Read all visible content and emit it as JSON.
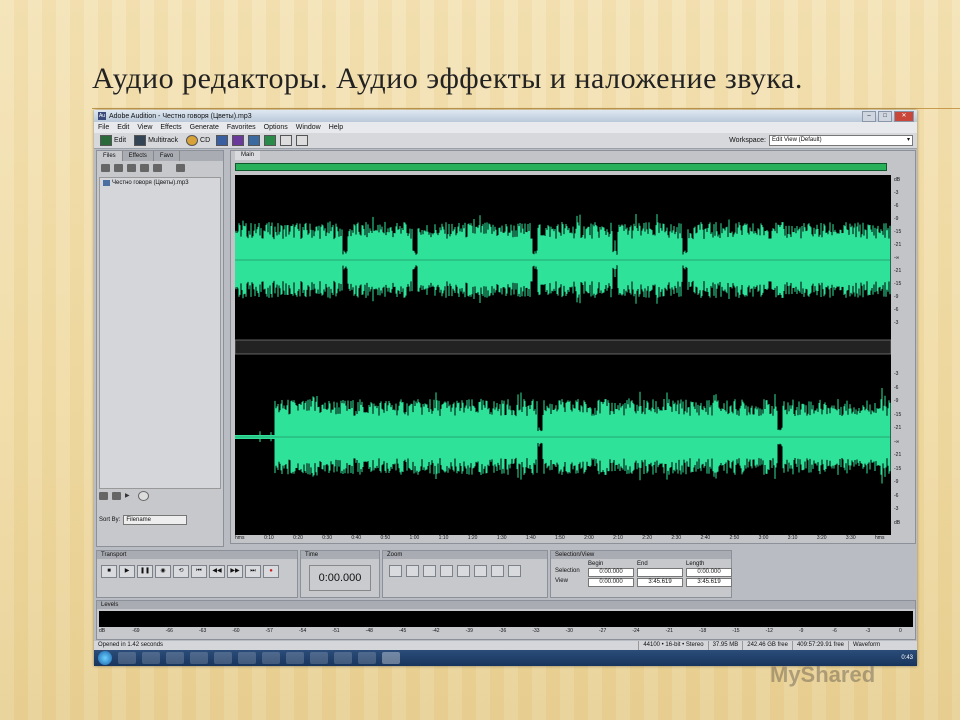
{
  "slide_title": "Аудио редакторы. Аудио эффекты и наложение звука.",
  "watermark": "MyShared",
  "app": {
    "title": "Adobe Audition - Честно говоря (Цветы).mp3",
    "menu": [
      "File",
      "Edit",
      "View",
      "Effects",
      "Generate",
      "Favorites",
      "Options",
      "Window",
      "Help"
    ],
    "toolbar": {
      "edit": "Edit",
      "multitrack": "Multitrack",
      "cd": "CD"
    },
    "workspace_label": "Workspace:",
    "workspace_value": "Edit View (Default)"
  },
  "files_panel": {
    "tabs": [
      "Files",
      "Effects",
      "Favo"
    ],
    "file": "Честно говоря (Цветы).mp3",
    "sort_label": "Sort By:",
    "sort_value": "Filename"
  },
  "editor": {
    "tab": "Main",
    "db_top": [
      "dB",
      "-3",
      "-6",
      "-9",
      "-15",
      "-21",
      "-∞",
      "-21",
      "-15",
      "-9",
      "-6",
      "-3"
    ],
    "db_bottom": [
      "-3",
      "-6",
      "-9",
      "-15",
      "-21",
      "-∞",
      "-21",
      "-15",
      "-9",
      "-6",
      "-3",
      "dB"
    ],
    "timeline": [
      "hms",
      "0:10",
      "0:20",
      "0:30",
      "0:40",
      "0:50",
      "1:00",
      "1:10",
      "1:20",
      "1:30",
      "1:40",
      "1:50",
      "2:00",
      "2:10",
      "2:20",
      "2:30",
      "2:40",
      "2:50",
      "3:00",
      "3:10",
      "3:20",
      "3:30",
      "hms"
    ],
    "wave_color": "#2fe29a"
  },
  "transport": {
    "tab": "Transport"
  },
  "time": {
    "tab": "Time",
    "value": "0:00.000"
  },
  "zoom": {
    "tab": "Zoom"
  },
  "selection": {
    "tab": "Selection/View",
    "headers": [
      "Begin",
      "End",
      "Length"
    ],
    "sel_label": "Selection",
    "view_label": "View",
    "sel": [
      "0:00.000",
      "",
      "0:00.000"
    ],
    "view": [
      "0:00.000",
      "3:45.619",
      "3:45.619"
    ]
  },
  "levels": {
    "tab": "Levels",
    "scale": [
      "dB",
      "-69",
      "-66",
      "-63",
      "-60",
      "-57",
      "-54",
      "-51",
      "-48",
      "-45",
      "-42",
      "-39",
      "-36",
      "-33",
      "-30",
      "-27",
      "-24",
      "-21",
      "-18",
      "-15",
      "-12",
      "-9",
      "-6",
      "-3",
      "0"
    ]
  },
  "status": {
    "left": "Opened in 1.42 seconds",
    "cells": [
      "44100 • 16-bit • Stereo",
      "37.95 MB",
      "242.46 GB free",
      "409:57:29.91 free",
      "Waveform"
    ]
  },
  "clock": "0:43"
}
